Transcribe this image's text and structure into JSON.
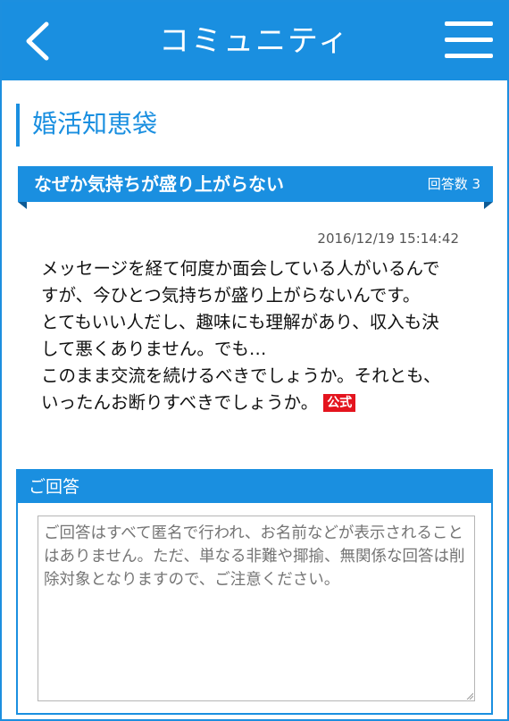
{
  "header": {
    "title": "コミュニティ",
    "back_icon": "chevron-left-icon",
    "menu_icon": "hamburger-menu-icon"
  },
  "section": {
    "title": "婚活知恵袋"
  },
  "question": {
    "title": "なぜか気持ちが盛り上がらない",
    "answer_count": "回答数 3",
    "timestamp": "2016/12/19 15:14:42",
    "lines": [
      "メッセージを経て何度か面会している人がいるんで",
      "すが、今ひとつ気持ちが盛り上がらないんです。",
      "とてもいい人だし、趣味にも理解があり、収入も決",
      "して悪くありません。でも…",
      "このまま交流を続けるべきでしょうか。それとも、",
      "いったんお断りすべきでしょうか。"
    ],
    "badge": "公式"
  },
  "answer": {
    "header": "ご回答",
    "placeholder": "ご回答はすべて匿名で行われ、お名前などが表示されることはありません。ただ、単なる非難や揶揄、無関係な回答は削除対象となりますので、ご注意ください。"
  },
  "colors": {
    "accent": "#1a8fe0",
    "badge": "#e4141e"
  }
}
